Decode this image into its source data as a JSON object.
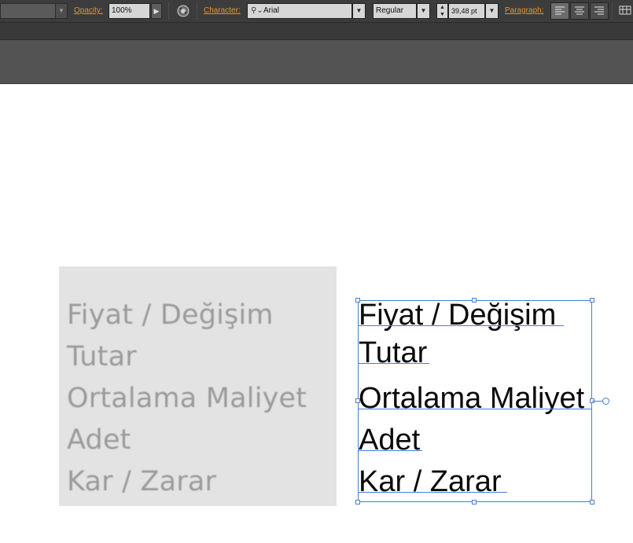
{
  "control_bar": {
    "opacity_label": "Opacity:",
    "opacity_value": "100%",
    "character_label": "Character:",
    "font_family": "Arial",
    "font_style": "Regular",
    "font_size": "39,48 pt",
    "paragraph_label": "Paragraph:"
  },
  "placed_image": {
    "lines": [
      "Fiyat / Değişim",
      "Tutar",
      "Ortalama Maliyet",
      "Adet",
      "Kar / Zarar"
    ]
  },
  "text_frame": {
    "lines": [
      "Fiyat / Değişim",
      "Tutar",
      "Ortalama Maliyet",
      "Adet",
      "Kar / Zarar"
    ]
  },
  "colors": {
    "label_accent": "#e8942a",
    "selection": "#4a7bd8",
    "panel_dark": "#3c3c3c"
  }
}
